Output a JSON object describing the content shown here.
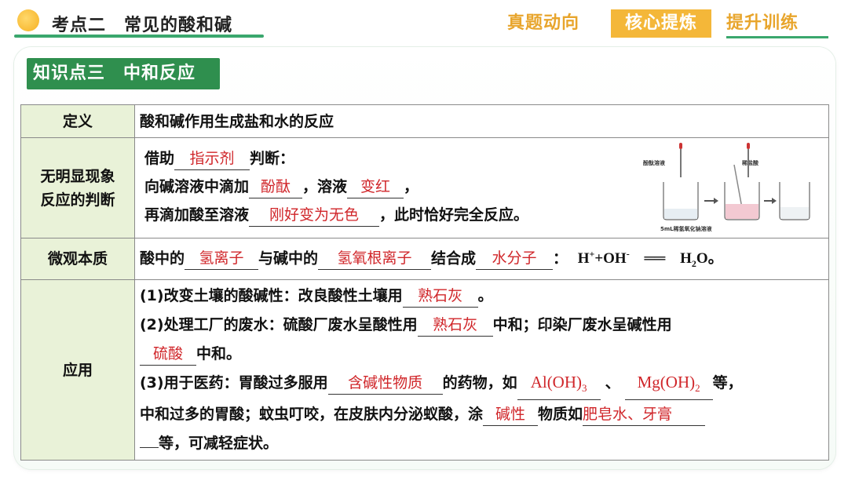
{
  "header": {
    "title": "考点二　常见的酸和碱",
    "nav": [
      "真题动向",
      "核心提炼",
      "提升训练"
    ],
    "nav_active": "核心提炼",
    "accent_green": "#2f8f4e",
    "accent_orange": "#f4b739"
  },
  "section": {
    "tag": "知识点三　中和反应"
  },
  "table": {
    "definition": {
      "head": "定义",
      "text": "酸和碱作用生成盐和水的反应"
    },
    "judgement": {
      "head_line1": "无明显现象",
      "head_line2": "反应的判断",
      "line1_pre": "借助",
      "blank1": "指示剂",
      "line1_post": "判断：",
      "line2_pre": "向碱溶液中滴加",
      "blank2": "酚酞",
      "line2_mid": "，溶液",
      "blank3": "变红",
      "line2_post": "，",
      "line3_pre": "再滴加酸至溶液",
      "blank4": "刚好变为无色",
      "line3_post": "，此时恰好完全反应。",
      "diagram": {
        "label_left": "酚酞溶液",
        "label_right": "稀盐酸",
        "caption": "5mL稀氢氧化钠溶液"
      }
    },
    "essence": {
      "head": "微观本质",
      "pre": "酸中的",
      "blank1": "氢离子",
      "mid1": "与碱中的",
      "blank2": "氢氧根离子",
      "mid2": "结合成",
      "blank3": "水分子",
      "colon": "：",
      "eq_h": "H",
      "eq_plus_sup": "+",
      "eq_plus": "+OH",
      "eq_minus_sup": "-",
      "eq_arrow": "══",
      "eq_h2": "H",
      "eq_2": "2",
      "eq_o": "O",
      "end": "。"
    },
    "application": {
      "head": "应用",
      "item1_pre": "(1)改变土壤的酸碱性：改良酸性土壤用",
      "item1_blank": "熟石灰",
      "item1_post": "。",
      "item2_pre": "(2)处理工厂的废水：硫酸厂废水呈酸性用",
      "item2_blank1": "熟石灰",
      "item2_mid": "中和；印染厂废水呈碱性用",
      "item2_blank2": "硫酸",
      "item2_post": "中和。",
      "item3_pre": "(3)用于医药：胃酸过多服用",
      "item3_blank1": "含碱性物质",
      "item3_mid1": "的药物，如",
      "item3_blank2": "Al(OH)",
      "item3_blank2_sub": "3",
      "item3_sep": "、",
      "item3_blank3": "Mg(OH)",
      "item3_blank3_sub": "2",
      "item3_post1": "等，",
      "item3_line2_pre": "中和过多的胃酸；蚊虫叮咬，在皮肤内分泌蚁酸，涂",
      "item3_blank4": "碱性",
      "item3_mid2": "物质如",
      "item3_blank5": "肥皂水、牙膏",
      "item3_line3_post": "等，可减轻症状。"
    }
  }
}
